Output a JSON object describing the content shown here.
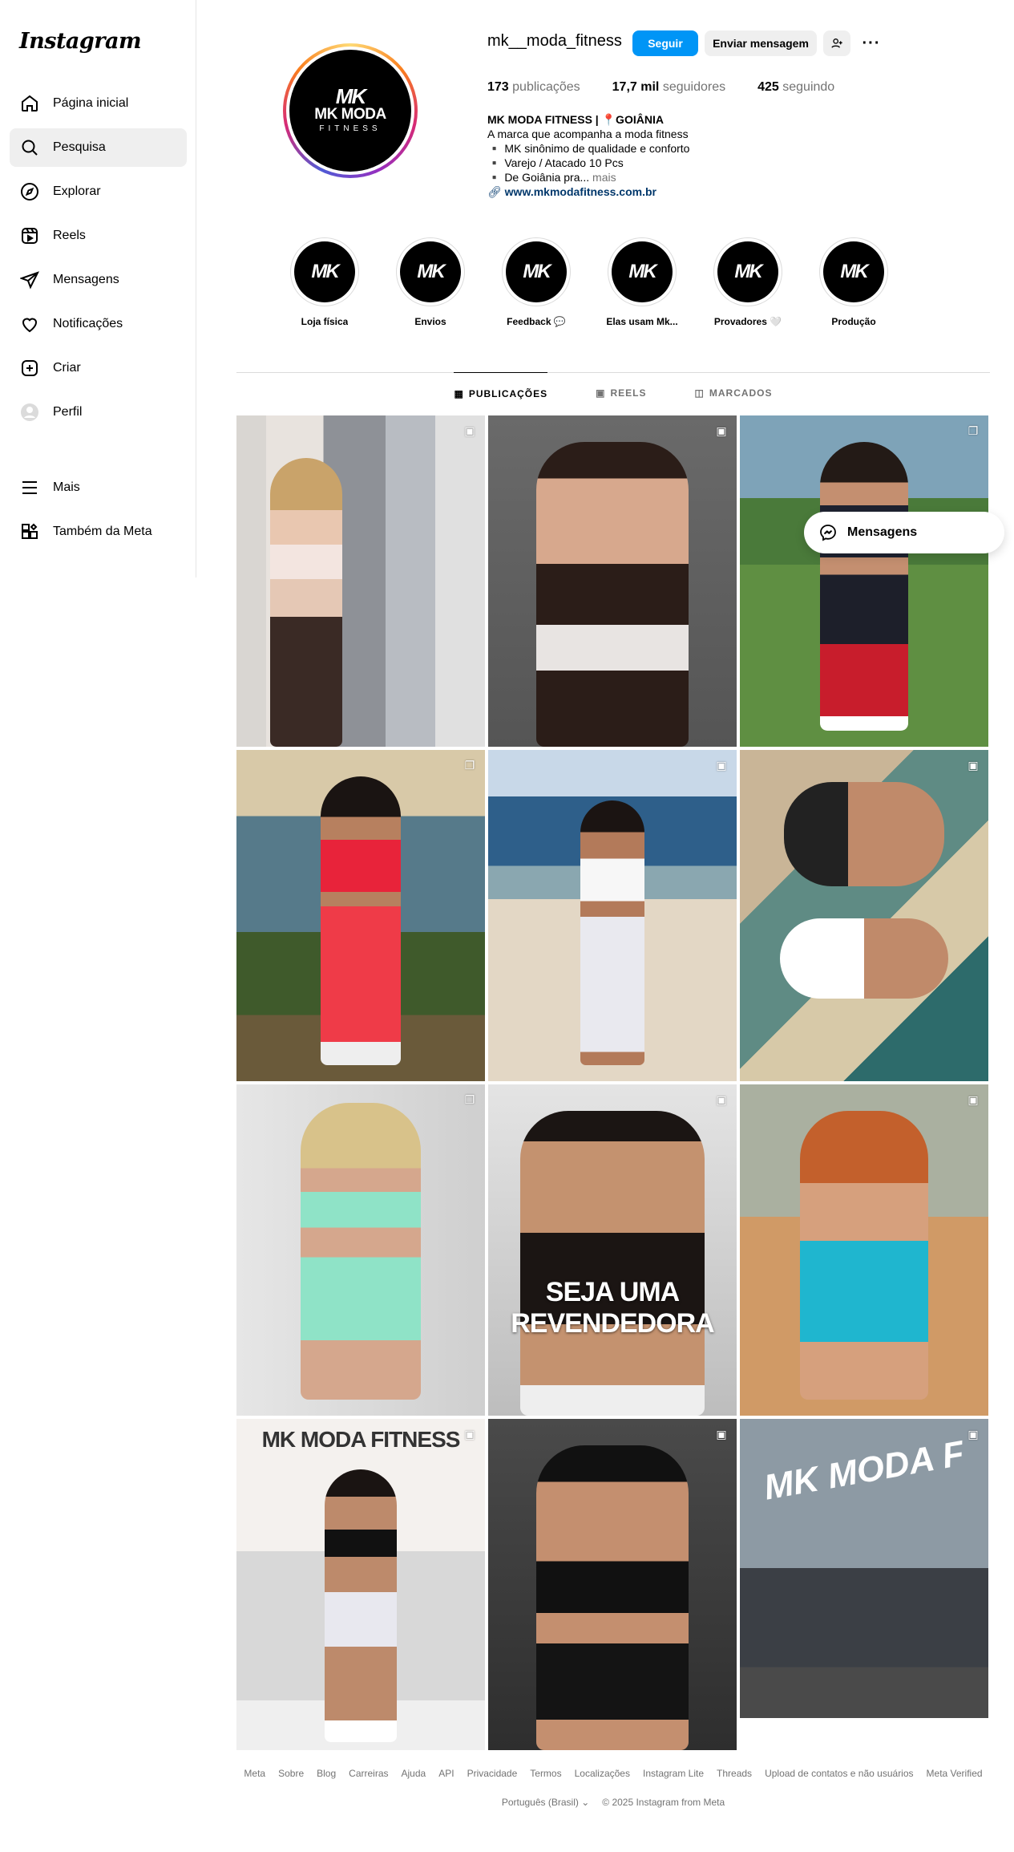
{
  "app": {
    "logo": "Instagram"
  },
  "sidebar": {
    "items": [
      {
        "label": "Página inicial",
        "icon": "home-icon"
      },
      {
        "label": "Pesquisa",
        "icon": "search-icon"
      },
      {
        "label": "Explorar",
        "icon": "compass-icon"
      },
      {
        "label": "Reels",
        "icon": "reels-icon"
      },
      {
        "label": "Mensagens",
        "icon": "send-icon"
      },
      {
        "label": "Notificações",
        "icon": "heart-icon"
      },
      {
        "label": "Criar",
        "icon": "plus-square-icon"
      },
      {
        "label": "Perfil",
        "icon": "profile-avatar-icon"
      },
      {
        "label": "Mais",
        "icon": "menu-icon"
      },
      {
        "label": "Também da Meta",
        "icon": "meta-apps-icon"
      }
    ],
    "active_index": 1
  },
  "profile": {
    "avatar": {
      "mark": "MK",
      "brand": "MK MODA",
      "sub": "FITNESS"
    },
    "username": "mk__moda_fitness",
    "follow_label": "Seguir",
    "message_label": "Enviar mensagem",
    "more_label": "···",
    "stats": {
      "posts_value": "173",
      "posts_label": "publicações",
      "followers_value": "17,7 mil",
      "followers_label": "seguidores",
      "following_value": "425",
      "following_label": "seguindo"
    },
    "bio": {
      "name": "MK MODA FITNESS | 📍GOIÂNIA",
      "line1": "A marca que acompanha a moda fitness",
      "line2": "▪️ MK sinônimo de qualidade e conforto",
      "line3": "▪️ Varejo / Atacado 10 Pcs",
      "line4": "▪️ De Goiânia pra...",
      "more": "mais",
      "link": "www.mkmodafitness.com.br"
    }
  },
  "highlights": [
    {
      "label": "Loja física",
      "mark": "MK"
    },
    {
      "label": "Envios",
      "mark": "MK"
    },
    {
      "label": "Feedback 💬",
      "mark": "MK"
    },
    {
      "label": "Elas usam Mk...",
      "mark": "MK"
    },
    {
      "label": "Provadores 🤍",
      "mark": "MK"
    },
    {
      "label": "Produção",
      "mark": "MK"
    }
  ],
  "tabs": [
    {
      "label": "PUBLICAÇÕES",
      "icon": "grid-icon",
      "active": true
    },
    {
      "label": "REELS",
      "icon": "reels-icon",
      "active": false
    },
    {
      "label": "MARCADOS",
      "icon": "tagged-icon",
      "active": false
    }
  ],
  "posts": [
    {
      "type": "pinned-reel",
      "overlay": ""
    },
    {
      "type": "reel",
      "overlay": ""
    },
    {
      "type": "carousel",
      "overlay": ""
    },
    {
      "type": "carousel",
      "overlay": ""
    },
    {
      "type": "reel",
      "overlay": ""
    },
    {
      "type": "reel",
      "overlay": ""
    },
    {
      "type": "carousel",
      "overlay": ""
    },
    {
      "type": "reel",
      "overlay": "SEJA UMA REVENDEDORA"
    },
    {
      "type": "reel",
      "overlay": ""
    },
    {
      "type": "reel",
      "overlay": "MK MODA FITNESS"
    },
    {
      "type": "reel",
      "overlay": ""
    },
    {
      "type": "reel",
      "overlay": "MK MODA F"
    }
  ],
  "messages_pill": {
    "label": "Mensagens"
  },
  "footer": {
    "links": [
      "Meta",
      "Sobre",
      "Blog",
      "Carreiras",
      "Ajuda",
      "API",
      "Privacidade",
      "Termos",
      "Localizações",
      "Instagram Lite",
      "Threads",
      "Upload de contatos e não usuários",
      "Meta Verified"
    ],
    "language": "Português (Brasil) ⌄",
    "copyright": "© 2025 Instagram from Meta"
  },
  "colors": {
    "primary": "#0095f6",
    "secondary_bg": "#efefef",
    "muted_text": "#737373",
    "link": "#00376b"
  }
}
